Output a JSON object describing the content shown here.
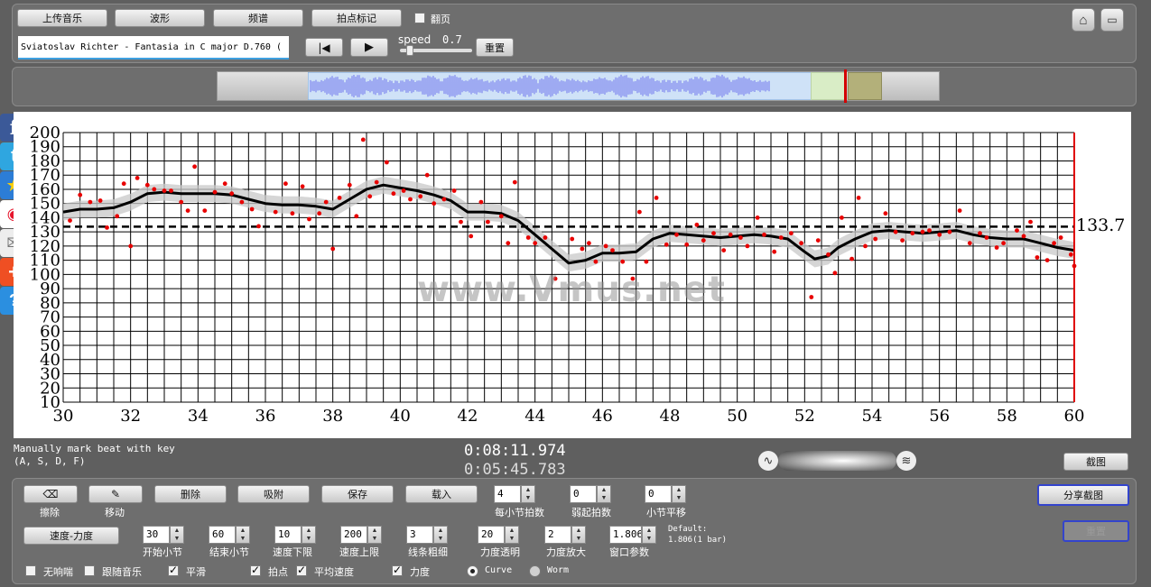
{
  "top_toolbar": {
    "upload": "上传音乐",
    "waveform": "波形",
    "spectrum": "频谱",
    "beat_mark": "拍点标记",
    "page_turn": "翻页",
    "page_turn_checked": false
  },
  "track_title": "Sviatoslav Richter - Fantasia in C major D.760 (",
  "speed_label": "speed",
  "speed_value": "0.7",
  "speed_level": 0.1,
  "reset_label": "重置",
  "watermark": "www.Vmus.net",
  "mean_label": "133.7",
  "hint": {
    "line1": "Manually mark beat with key",
    "line2": "(A, S, D, F)"
  },
  "time_current": "0:08:11.974",
  "time_total": "0:05:45.783",
  "screenshot_label": "截图",
  "share_label": "分享截图",
  "faded_btn": "重置",
  "edit_tools": {
    "erase": "擦除",
    "move": "移动",
    "delete": "删除",
    "snap": "吸附",
    "save": "保存",
    "load": "载入",
    "beats_per_bar": {
      "value": "4",
      "label": "每小节拍数"
    },
    "pickup_beats": {
      "value": "0",
      "label": "弱起拍数"
    },
    "bar_shift": {
      "value": "0",
      "label": "小节平移"
    }
  },
  "params": {
    "tempo_dynamics": "速度-力度",
    "start_bar": {
      "value": "30",
      "label": "开始小节"
    },
    "end_bar": {
      "value": "60",
      "label": "结束小节"
    },
    "tempo_low": {
      "value": "10",
      "label": "速度下限"
    },
    "tempo_high": {
      "value": "200",
      "label": "速度上限"
    },
    "line_width": {
      "value": "3",
      "label": "线条粗细"
    },
    "dyn_transparency": {
      "value": "20",
      "label": "力度透明"
    },
    "dyn_scale": {
      "value": "2",
      "label": "力度放大"
    },
    "window_param": {
      "value": "1.806",
      "label": "窗口参数"
    },
    "default_line1": "Default:",
    "default_line2": "1.806(1 bar)"
  },
  "options": {
    "metronome": {
      "label": "无响喘",
      "checked": false
    },
    "follow_music": {
      "label": "跟随音乐",
      "checked": false
    },
    "smooth": {
      "label": "平滑",
      "checked": true
    },
    "beats": {
      "label": "拍点",
      "checked": true
    },
    "avg_tempo": {
      "label": "平均速度",
      "checked": true
    },
    "dynamics": {
      "label": "力度",
      "checked": true
    },
    "curve": {
      "label": "Curve",
      "selected": true
    },
    "worm": {
      "label": "Worm",
      "selected": false
    }
  },
  "colors": {
    "accent_red": "#e00000",
    "wave_blue": "#7e86f0",
    "band_gray": "#c8c8c8"
  },
  "chart_data": {
    "type": "scatter",
    "title": "",
    "xlabel": "",
    "ylabel": "",
    "xlim": [
      30,
      60
    ],
    "ylim": [
      10,
      200
    ],
    "x_ticks": [
      30,
      32,
      34,
      36,
      38,
      40,
      42,
      44,
      46,
      48,
      50,
      52,
      54,
      56,
      58,
      60
    ],
    "y_ticks": [
      10,
      20,
      30,
      40,
      50,
      60,
      70,
      80,
      90,
      100,
      110,
      120,
      130,
      140,
      150,
      160,
      170,
      180,
      190,
      200
    ],
    "mean_tempo": 133.7,
    "points": [
      [
        30.2,
        138
      ],
      [
        30.5,
        156
      ],
      [
        30.8,
        151
      ],
      [
        31.1,
        152
      ],
      [
        31.3,
        133
      ],
      [
        31.6,
        141
      ],
      [
        31.8,
        164
      ],
      [
        32.0,
        120
      ],
      [
        32.2,
        168
      ],
      [
        32.5,
        163
      ],
      [
        32.7,
        160
      ],
      [
        33.0,
        159
      ],
      [
        33.2,
        159
      ],
      [
        33.5,
        151
      ],
      [
        33.7,
        145
      ],
      [
        33.9,
        176
      ],
      [
        34.2,
        145
      ],
      [
        34.5,
        158
      ],
      [
        34.8,
        164
      ],
      [
        35.0,
        157
      ],
      [
        35.3,
        151
      ],
      [
        35.6,
        146
      ],
      [
        35.8,
        134
      ],
      [
        36.3,
        144
      ],
      [
        36.6,
        164
      ],
      [
        36.8,
        143
      ],
      [
        37.1,
        162
      ],
      [
        37.3,
        139
      ],
      [
        37.6,
        143
      ],
      [
        37.8,
        151
      ],
      [
        38.0,
        118
      ],
      [
        38.2,
        154
      ],
      [
        38.5,
        163
      ],
      [
        38.7,
        141
      ],
      [
        38.9,
        195
      ],
      [
        39.1,
        155
      ],
      [
        39.3,
        165
      ],
      [
        39.6,
        179
      ],
      [
        39.8,
        157
      ],
      [
        40.1,
        159
      ],
      [
        40.3,
        153
      ],
      [
        40.6,
        155
      ],
      [
        40.8,
        170
      ],
      [
        41.0,
        150
      ],
      [
        41.3,
        153
      ],
      [
        41.6,
        159
      ],
      [
        41.8,
        137
      ],
      [
        42.1,
        127
      ],
      [
        42.4,
        151
      ],
      [
        42.6,
        137
      ],
      [
        43.0,
        141
      ],
      [
        43.2,
        122
      ],
      [
        43.4,
        165
      ],
      [
        43.8,
        126
      ],
      [
        44.0,
        122
      ],
      [
        44.3,
        126
      ],
      [
        44.6,
        97
      ],
      [
        45.1,
        125
      ],
      [
        45.4,
        118
      ],
      [
        45.6,
        122
      ],
      [
        45.8,
        109
      ],
      [
        46.1,
        120
      ],
      [
        46.3,
        117
      ],
      [
        46.6,
        109
      ],
      [
        46.9,
        97
      ],
      [
        47.1,
        144
      ],
      [
        47.3,
        109
      ],
      [
        47.6,
        154
      ],
      [
        47.9,
        121
      ],
      [
        48.2,
        128
      ],
      [
        48.5,
        121
      ],
      [
        48.8,
        135
      ],
      [
        49.0,
        124
      ],
      [
        49.3,
        129
      ],
      [
        49.6,
        117
      ],
      [
        49.8,
        128
      ],
      [
        50.1,
        126
      ],
      [
        50.3,
        120
      ],
      [
        50.6,
        140
      ],
      [
        50.8,
        128
      ],
      [
        51.1,
        116
      ],
      [
        51.3,
        126
      ],
      [
        51.6,
        129
      ],
      [
        51.9,
        122
      ],
      [
        52.2,
        84
      ],
      [
        52.4,
        124
      ],
      [
        52.7,
        114
      ],
      [
        52.9,
        101
      ],
      [
        53.1,
        140
      ],
      [
        53.4,
        111
      ],
      [
        53.6,
        154
      ],
      [
        53.8,
        120
      ],
      [
        54.1,
        125
      ],
      [
        54.4,
        143
      ],
      [
        54.7,
        130
      ],
      [
        54.9,
        124
      ],
      [
        55.2,
        129
      ],
      [
        55.5,
        130
      ],
      [
        55.7,
        131
      ],
      [
        56.0,
        128
      ],
      [
        56.3,
        130
      ],
      [
        56.6,
        145
      ],
      [
        56.9,
        122
      ],
      [
        57.2,
        129
      ],
      [
        57.4,
        126
      ],
      [
        57.7,
        119
      ],
      [
        57.9,
        122
      ],
      [
        58.3,
        131
      ],
      [
        58.5,
        127
      ],
      [
        58.7,
        137
      ],
      [
        58.9,
        112
      ],
      [
        59.2,
        110
      ],
      [
        59.4,
        122
      ],
      [
        59.6,
        126
      ],
      [
        59.9,
        114
      ],
      [
        60.0,
        106
      ]
    ],
    "smooth_curve": [
      [
        30,
        144
      ],
      [
        30.5,
        146
      ],
      [
        31,
        146
      ],
      [
        31.5,
        147
      ],
      [
        32,
        151
      ],
      [
        32.5,
        157
      ],
      [
        33,
        158
      ],
      [
        33.5,
        157
      ],
      [
        34,
        157
      ],
      [
        34.5,
        157
      ],
      [
        35,
        156
      ],
      [
        35.5,
        153
      ],
      [
        36,
        150
      ],
      [
        36.5,
        149
      ],
      [
        37,
        149
      ],
      [
        37.5,
        148
      ],
      [
        38,
        146
      ],
      [
        38.5,
        153
      ],
      [
        39,
        160
      ],
      [
        39.5,
        163
      ],
      [
        40,
        161
      ],
      [
        40.5,
        159
      ],
      [
        41,
        156
      ],
      [
        41.5,
        152
      ],
      [
        42,
        144
      ],
      [
        42.5,
        144
      ],
      [
        43,
        143
      ],
      [
        43.5,
        138
      ],
      [
        44,
        128
      ],
      [
        44.5,
        118
      ],
      [
        45,
        108
      ],
      [
        45.5,
        110
      ],
      [
        46,
        115
      ],
      [
        46.5,
        115
      ],
      [
        47,
        116
      ],
      [
        47.5,
        125
      ],
      [
        48,
        129
      ],
      [
        48.5,
        128
      ],
      [
        49,
        127
      ],
      [
        49.5,
        126
      ],
      [
        50,
        127
      ],
      [
        50.5,
        128
      ],
      [
        51,
        127
      ],
      [
        51.5,
        125
      ],
      [
        52,
        116
      ],
      [
        52.3,
        111
      ],
      [
        52.7,
        113
      ],
      [
        53,
        119
      ],
      [
        53.5,
        125
      ],
      [
        54,
        130
      ],
      [
        54.5,
        131
      ],
      [
        55,
        130
      ],
      [
        55.5,
        129
      ],
      [
        56,
        130
      ],
      [
        56.5,
        131
      ],
      [
        57,
        128
      ],
      [
        57.5,
        126
      ],
      [
        58,
        125
      ],
      [
        58.5,
        125
      ],
      [
        59,
        122
      ],
      [
        59.5,
        119
      ],
      [
        60,
        117
      ]
    ]
  }
}
